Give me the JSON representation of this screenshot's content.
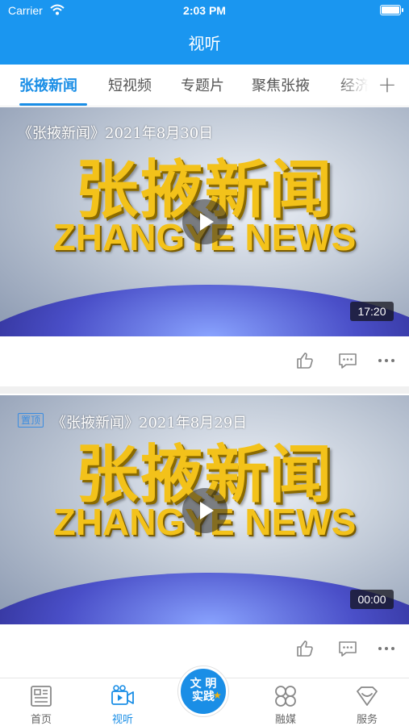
{
  "status_bar": {
    "carrier": "Carrier",
    "time": "2:03 PM"
  },
  "header": {
    "title": "视听"
  },
  "tabs": [
    {
      "label": "张掖新闻",
      "active": true
    },
    {
      "label": "短视频",
      "active": false
    },
    {
      "label": "专题片",
      "active": false
    },
    {
      "label": "聚焦张掖",
      "active": false
    },
    {
      "label": "经济",
      "active": false
    }
  ],
  "videos": [
    {
      "title": "《张掖新闻》2021年8月30日",
      "duration": "17:20",
      "logo_cn": "张掖新闻",
      "logo_en": "ZHANGYE NEWS"
    },
    {
      "tag": "置顶",
      "title": "《张掖新闻》2021年8月29日",
      "duration": "00:00",
      "logo_cn": "张掖新闻",
      "logo_en": "ZHANGYE NEWS"
    }
  ],
  "bottom_nav": {
    "items": [
      {
        "label": "首页",
        "icon": "news-icon"
      },
      {
        "label": "视听",
        "icon": "video-camera-icon",
        "active": true
      },
      {
        "label": "融媒",
        "icon": "grid-icon"
      },
      {
        "label": "服务",
        "icon": "heart-icon"
      }
    ],
    "center": {
      "line1": "文 明",
      "line2": "实践"
    }
  },
  "colors": {
    "primary": "#1a96f0",
    "active_tab": "#1a8ee6",
    "logo_gold": "#f3c21a"
  }
}
